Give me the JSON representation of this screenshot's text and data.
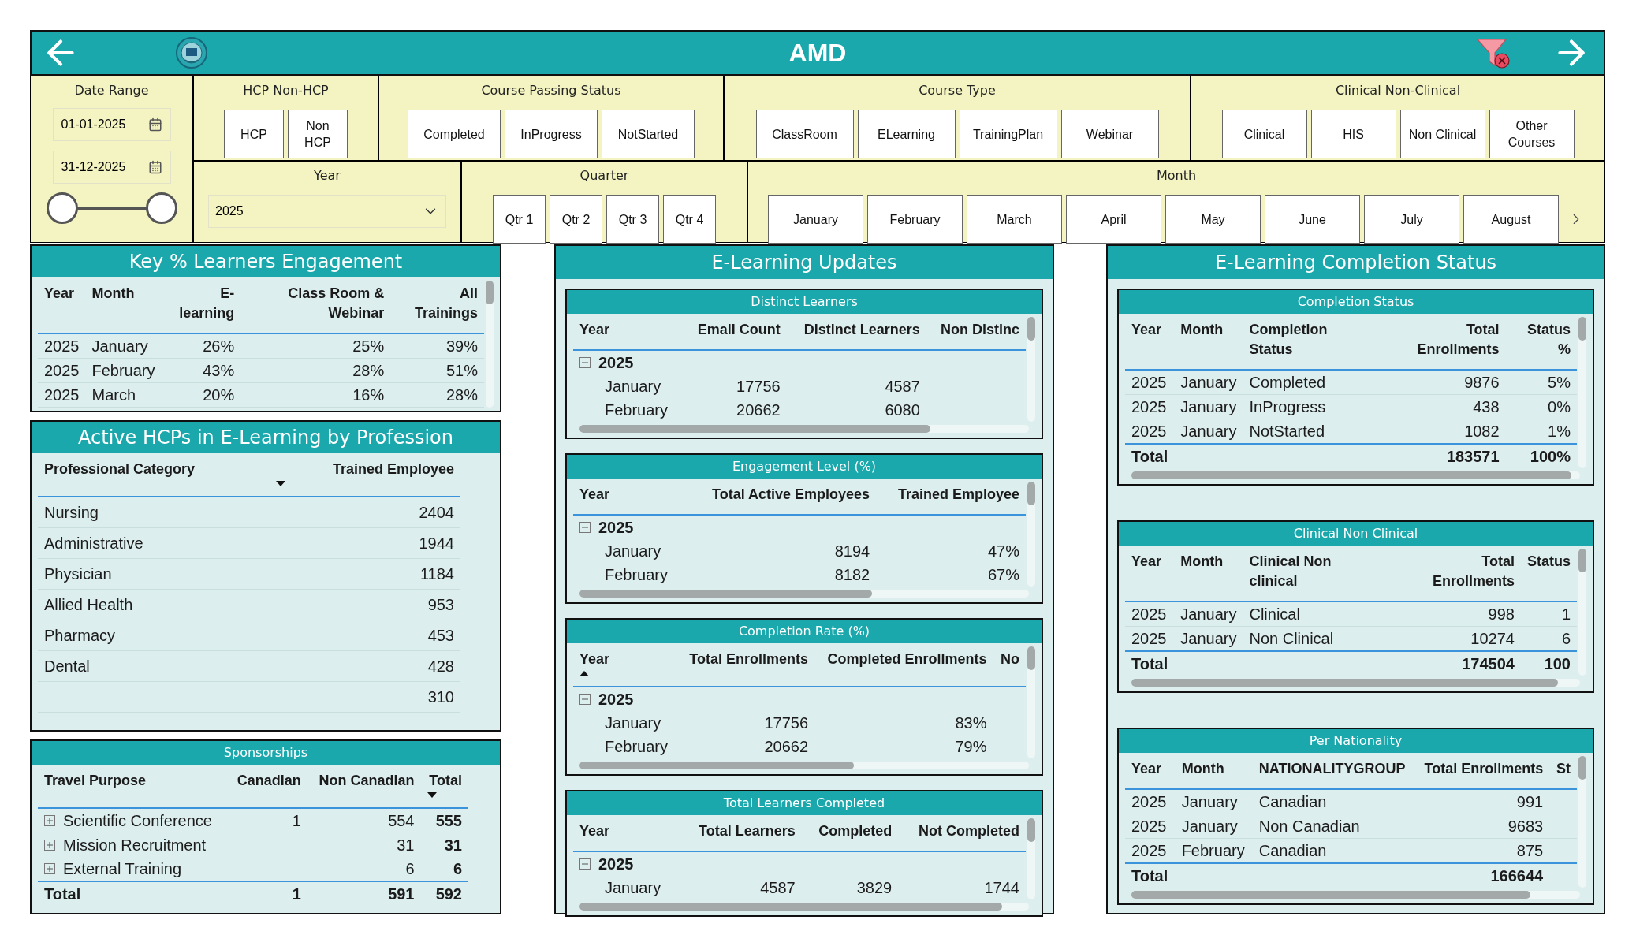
{
  "header": {
    "title": "AMD"
  },
  "date_range": {
    "label": "Date Range",
    "start": "01-01-2025",
    "end": "31-12-2025",
    "handles": [
      {
        "level": 0
      },
      {
        "level": 1
      }
    ]
  },
  "hcp": {
    "label": "HCP Non-HCP",
    "options": [
      "HCP",
      "Non HCP"
    ]
  },
  "course_passing_status": {
    "label": "Course Passing Status",
    "options": [
      "Completed",
      "InProgress",
      "NotStarted"
    ]
  },
  "course_type": {
    "label": "Course Type",
    "options": [
      "ClassRoom",
      "ELearning",
      "TrainingPlan",
      "Webinar"
    ]
  },
  "clinical": {
    "label": "Clinical Non-Clinical",
    "options": [
      "Clinical",
      "HIS",
      "Non Clinical",
      "Other Courses"
    ]
  },
  "year": {
    "label": "Year",
    "value": "2025"
  },
  "quarter": {
    "label": "Quarter",
    "options": [
      "Qtr 1",
      "Qtr 2",
      "Qtr 3",
      "Qtr 4"
    ]
  },
  "month": {
    "label": "Month",
    "options": [
      "January",
      "February",
      "March",
      "April",
      "May",
      "June",
      "July",
      "August"
    ],
    "more": true
  },
  "key_engagement": {
    "title": "Key % Learners Engagement",
    "columns": [
      {
        "label": "Year"
      },
      {
        "label": "Month"
      },
      {
        "label": "E-learning"
      },
      {
        "label": "Class Room & Webinar"
      },
      {
        "label": "All Trainings"
      }
    ],
    "rows": [
      {
        "kind": "data",
        "cells": [
          "2025",
          "January",
          "26%",
          "25%",
          "39%"
        ]
      },
      {
        "kind": "data",
        "cells": [
          "2025",
          "February",
          "43%",
          "28%",
          "51%"
        ]
      },
      {
        "kind": "data",
        "cells": [
          "2025",
          "March",
          "20%",
          "16%",
          "28%"
        ]
      }
    ]
  },
  "active_hcps": {
    "title": "Active HCPs in E-Learning by Profession",
    "columns": [
      {
        "label": "Professional Category"
      },
      {
        "label": "Trained Employee",
        "sorted": true,
        "descending": true
      }
    ],
    "rows": [
      {
        "kind": "data",
        "cells": [
          "Nursing",
          "2404"
        ]
      },
      {
        "kind": "data",
        "cells": [
          "Administrative",
          "1944"
        ]
      },
      {
        "kind": "data",
        "cells": [
          "Physician",
          "1184"
        ]
      },
      {
        "kind": "data",
        "cells": [
          "Allied Health",
          "953"
        ]
      },
      {
        "kind": "data",
        "cells": [
          "Pharmacy",
          "453"
        ]
      },
      {
        "kind": "data",
        "cells": [
          "Dental",
          "428"
        ]
      },
      {
        "kind": "data",
        "cells": [
          null,
          "310"
        ]
      }
    ]
  },
  "sponsorships": {
    "title": "Sponsorships",
    "columns": [
      {
        "label": "Travel Purpose"
      },
      {
        "label": "Canadian"
      },
      {
        "label": "Non Canadian"
      },
      {
        "label": "Total",
        "sorted": true,
        "descending": true,
        "emphasis": true
      }
    ],
    "rows": [
      {
        "kind": "group",
        "expanded": false,
        "cells": [
          "Scientific Conference",
          "1",
          "554",
          "555"
        ]
      },
      {
        "kind": "group",
        "expanded": false,
        "cells": [
          "Mission Recruitment",
          null,
          "31",
          "31"
        ]
      },
      {
        "kind": "group",
        "expanded": false,
        "cells": [
          "External Training",
          null,
          "6",
          "6"
        ]
      },
      {
        "kind": "total",
        "cells": [
          "Total",
          "1",
          "591",
          "592"
        ]
      }
    ]
  },
  "elearning_updates": {
    "title": "E-Learning Updates",
    "tables": [
      {
        "title": "Distinct Learners",
        "columns": [
          {
            "label": "Year"
          },
          {
            "label": "Email Count"
          },
          {
            "label": "Distinct Learners"
          },
          {
            "label": "Non Distinc"
          }
        ],
        "rows": [
          {
            "kind": "group",
            "expanded": true,
            "cells": [
              "2025",
              null,
              null,
              null
            ]
          },
          {
            "kind": "child",
            "cells": [
              "January",
              "17756",
              "4587",
              null
            ]
          },
          {
            "kind": "child",
            "cells": [
              "February",
              "20662",
              "6080",
              null
            ]
          }
        ]
      },
      {
        "title": "Engagement Level (%)",
        "columns": [
          {
            "label": "Year"
          },
          {
            "label": "Total Active Employees"
          },
          {
            "label": "Trained Employee"
          }
        ],
        "rows": [
          {
            "kind": "group",
            "expanded": true,
            "cells": [
              "2025",
              null,
              null
            ]
          },
          {
            "kind": "child",
            "cells": [
              "January",
              "8194",
              "47%"
            ]
          },
          {
            "kind": "child",
            "cells": [
              "February",
              "8182",
              "67%"
            ]
          }
        ]
      },
      {
        "title": "Completion Rate (%)",
        "columns": [
          {
            "label": "Year",
            "sorted": true,
            "descending": false
          },
          {
            "label": "Total Enrollments"
          },
          {
            "label": "Completed Enrollments"
          },
          {
            "label": "No"
          }
        ],
        "rows": [
          {
            "kind": "group",
            "expanded": true,
            "cells": [
              "2025",
              null,
              null,
              null
            ]
          },
          {
            "kind": "child",
            "cells": [
              "January",
              "17756",
              "83%",
              null
            ]
          },
          {
            "kind": "child",
            "cells": [
              "February",
              "20662",
              "79%",
              null
            ]
          }
        ]
      },
      {
        "title": "Total Learners Completed",
        "columns": [
          {
            "label": "Year"
          },
          {
            "label": "Total Learners"
          },
          {
            "label": "Completed"
          },
          {
            "label": "Not Completed"
          }
        ],
        "rows": [
          {
            "kind": "group",
            "expanded": true,
            "cells": [
              "2025",
              null,
              null,
              null
            ]
          },
          {
            "kind": "child",
            "cells": [
              "January",
              "4587",
              "3829",
              "1744"
            ]
          }
        ]
      }
    ]
  },
  "completion_panel": {
    "title": "E-Learning Completion Status",
    "tables": [
      {
        "title": "Completion Status",
        "columns": [
          {
            "label": "Year"
          },
          {
            "label": "Month"
          },
          {
            "label": "Completion Status"
          },
          {
            "label": "Total Enrollments"
          },
          {
            "label": "Status %"
          }
        ],
        "rows": [
          {
            "kind": "data",
            "cells": [
              "2025",
              "January",
              "Completed",
              "9876",
              "5%"
            ]
          },
          {
            "kind": "data",
            "cells": [
              "2025",
              "January",
              "InProgress",
              "438",
              "0%"
            ]
          },
          {
            "kind": "data",
            "cells": [
              "2025",
              "January",
              "NotStarted",
              "1082",
              "1%"
            ]
          },
          {
            "kind": "total",
            "cells": [
              "Total",
              null,
              null,
              "183571",
              "100%"
            ]
          }
        ]
      },
      {
        "title": "Clinical Non Clinical",
        "columns": [
          {
            "label": "Year"
          },
          {
            "label": "Month"
          },
          {
            "label": "Clinical Non clinical"
          },
          {
            "label": "Total Enrollments"
          },
          {
            "label": "Status"
          }
        ],
        "rows": [
          {
            "kind": "data",
            "cells": [
              "2025",
              "January",
              "Clinical",
              "998",
              "1"
            ]
          },
          {
            "kind": "data",
            "cells": [
              "2025",
              "January",
              "Non Clinical",
              "10274",
              "6"
            ]
          },
          {
            "kind": "total",
            "cells": [
              "Total",
              null,
              null,
              "174504",
              "100"
            ]
          }
        ]
      },
      {
        "title": "Per Nationality",
        "columns": [
          {
            "label": "Year"
          },
          {
            "label": "Month"
          },
          {
            "label": "NATIONALITYGROUP"
          },
          {
            "label": "Total Enrollments"
          },
          {
            "label": "St"
          }
        ],
        "rows": [
          {
            "kind": "data",
            "cells": [
              "2025",
              "January",
              "Canadian",
              "991",
              null
            ]
          },
          {
            "kind": "data",
            "cells": [
              "2025",
              "January",
              "Non Canadian",
              "9683",
              null
            ]
          },
          {
            "kind": "data",
            "cells": [
              "2025",
              "February",
              "Canadian",
              "875",
              null
            ]
          },
          {
            "kind": "total",
            "cells": [
              "Total",
              null,
              null,
              "166644",
              null
            ]
          }
        ]
      }
    ]
  }
}
